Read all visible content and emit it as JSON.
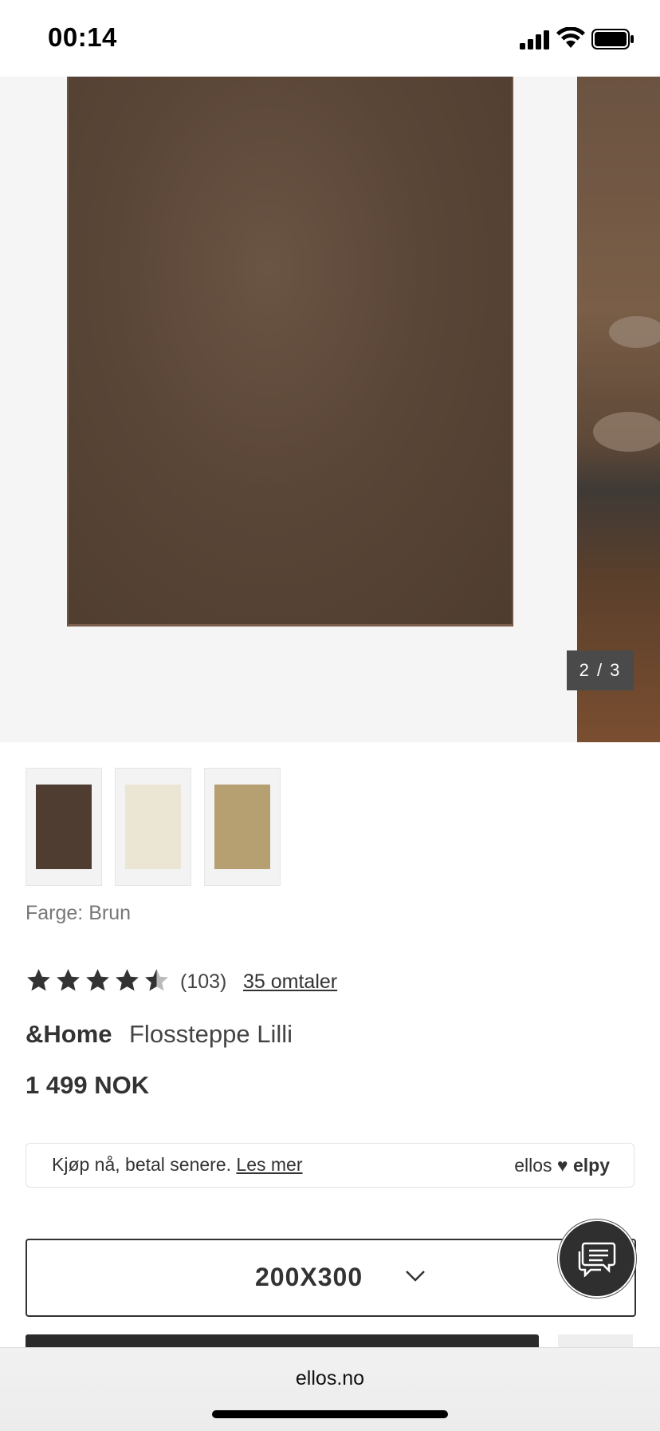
{
  "status_bar": {
    "time": "00:14"
  },
  "gallery": {
    "counter": "2 / 3"
  },
  "thumbnails": [
    {
      "name": "Brun",
      "color": "#4f3d31"
    },
    {
      "name": "Hvit",
      "color": "#ebe6d4"
    },
    {
      "name": "Beige",
      "color": "#b6a071"
    }
  ],
  "product": {
    "color_label": "Farge: Brun",
    "rating_value": 4.5,
    "rating_count": "(103)",
    "reviews_link": "35 omtaler",
    "brand": "&Home",
    "name": "Flossteppe Lilli",
    "price": "1 499 NOK"
  },
  "bnpl": {
    "text": "Kjøp nå, betal senere.",
    "link": "Les mer",
    "logo_left": "ellos",
    "logo_right": "elpy"
  },
  "size_select": {
    "value": "200X300"
  },
  "browser": {
    "url": "ellos.no"
  },
  "colors": {
    "rug_brown": "#4f3d31",
    "dark": "#333333"
  }
}
